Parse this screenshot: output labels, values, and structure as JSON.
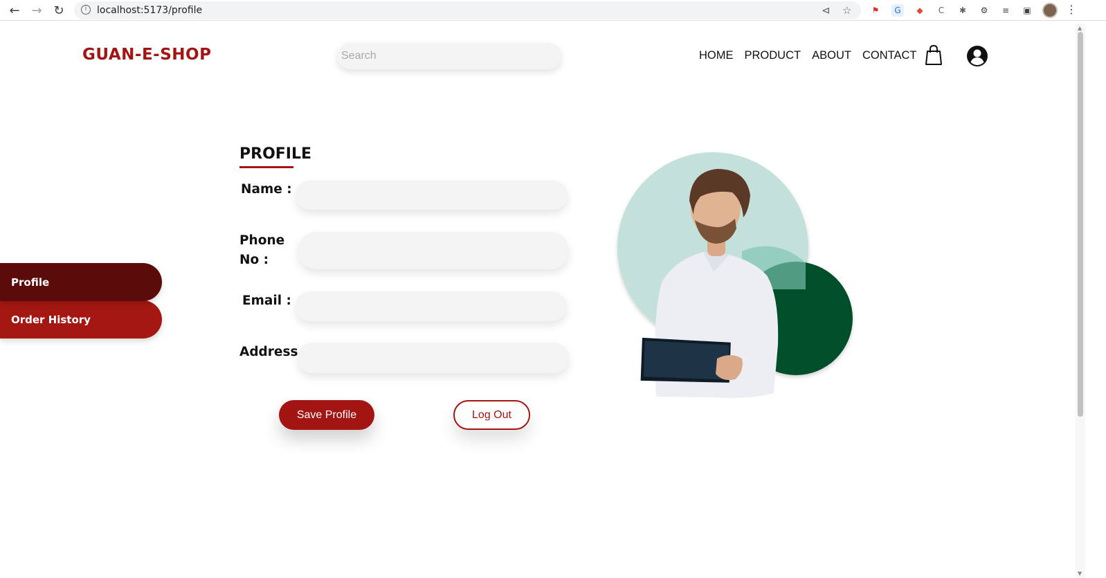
{
  "browser": {
    "url": "localhost:5173/profile",
    "info_icon": "info-icon"
  },
  "header": {
    "logo": "GUAN-E-SHOP",
    "search_placeholder": "Search",
    "nav": [
      "HOME",
      "PRODUCT",
      "ABOUT",
      "CONTACT"
    ],
    "brand_color": "#a31512"
  },
  "sidebar": {
    "items": [
      {
        "label": "Profile",
        "active": true,
        "color": "#5b0b09"
      },
      {
        "label": "Order History",
        "active": false,
        "color": "#a51712"
      }
    ]
  },
  "profile_form": {
    "title": "PROFILE",
    "fields": {
      "name_label": "Name :",
      "name_value": "",
      "phone_label_line1": "Phone",
      "phone_label_line2": "No :",
      "phone_value": "",
      "email_label": "Email :",
      "email_value": "",
      "address_label": "Address",
      "address_value": ""
    },
    "save_label": "Save Profile",
    "logout_label": "Log Out"
  },
  "illustration": {
    "circle_light": "#c3e0da",
    "circle_dark": "#00502c"
  }
}
